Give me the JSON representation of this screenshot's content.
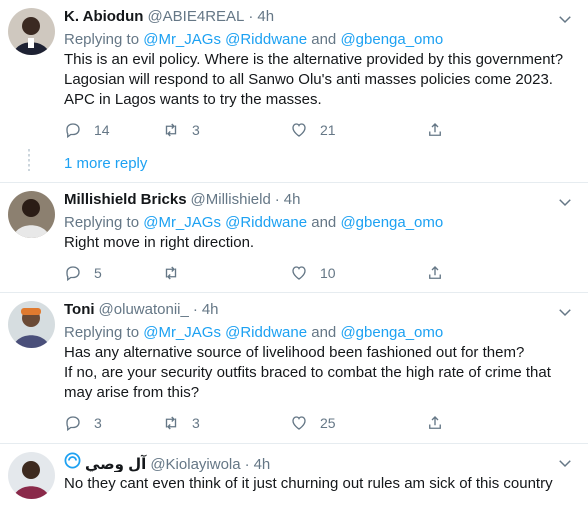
{
  "colors": {
    "link": "#1da1f2",
    "muted": "#657786",
    "text": "#14171a",
    "divider": "#e6ecf0"
  },
  "tweets": [
    {
      "name": "K. Abiodun",
      "handle": "@ABIE4REAL",
      "separator": "·",
      "time": "4h",
      "replying_prefix": "Replying to",
      "replying_mentions": "@Mr_JAGs @Riddwane",
      "replying_and": "and",
      "replying_last": "@gbenga_omo",
      "lines": [
        "This is an evil policy. Where is the alternative provided by this government?",
        "Lagosian will respond to all Sanwo Olu's anti masses policies come 2023.",
        "APC in Lagos wants to try the masses."
      ],
      "replies": "14",
      "retweets": "3",
      "likes": "21"
    },
    {
      "name": "Millishield Bricks",
      "handle": "@Millishield",
      "separator": "·",
      "time": "4h",
      "replying_prefix": "Replying to",
      "replying_mentions": "@Mr_JAGs @Riddwane",
      "replying_and": "and",
      "replying_last": "@gbenga_omo",
      "lines": [
        "Right move in right direction."
      ],
      "replies": "5",
      "retweets": "",
      "likes": "10"
    },
    {
      "name": "Toni",
      "handle": "@oluwatonii_",
      "separator": "·",
      "time": "4h",
      "replying_prefix": "Replying to",
      "replying_mentions": "@Mr_JAGs @Riddwane",
      "replying_and": "and",
      "replying_last": "@gbenga_omo",
      "lines": [
        "Has any alternative source of livelihood been fashioned out for them?",
        "If no, are your security outfits braced to combat the high rate of crime that",
        "may arise from this?"
      ],
      "replies": "3",
      "retweets": "3",
      "likes": "25"
    },
    {
      "name": "آل وصي",
      "handle": "@Kiolayiwola",
      "separator": "·",
      "time": "4h",
      "lines": [
        "No they cant even think of it just churning out rules am sick of this country"
      ]
    }
  ],
  "more_reply": "1 more reply",
  "icons": [
    "reply-icon",
    "retweet-icon",
    "like-icon",
    "share-icon",
    "chevron-down-icon",
    "badge-icon"
  ]
}
